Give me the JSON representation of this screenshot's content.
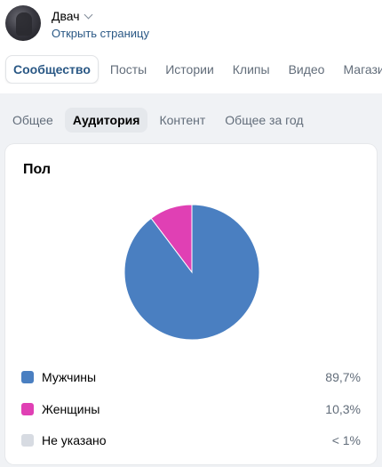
{
  "profile": {
    "name": "Двач",
    "open_link": "Открыть страницу"
  },
  "main_tabs": [
    {
      "label": "Сообщество",
      "active": true
    },
    {
      "label": "Посты",
      "active": false
    },
    {
      "label": "Истории",
      "active": false
    },
    {
      "label": "Клипы",
      "active": false
    },
    {
      "label": "Видео",
      "active": false
    },
    {
      "label": "Магазин",
      "active": false
    }
  ],
  "sub_tabs": [
    {
      "label": "Общее",
      "active": false
    },
    {
      "label": "Аудитория",
      "active": true
    },
    {
      "label": "Контент",
      "active": false
    },
    {
      "label": "Общее за год",
      "active": false
    }
  ],
  "card": {
    "title": "Пол"
  },
  "chart_data": {
    "type": "pie",
    "title": "Пол",
    "slices": [
      {
        "label": "Мужчины",
        "value": 89.7,
        "display": "89,7%",
        "color": "#4a7fc1"
      },
      {
        "label": "Женщины",
        "value": 10.3,
        "display": "10,3%",
        "color": "#e040b4"
      },
      {
        "label": "Не указано",
        "value": 0.0,
        "display": "< 1%",
        "color": "#d7dbe2"
      }
    ]
  },
  "icons": {
    "dropdown": "chevron-down-icon"
  }
}
